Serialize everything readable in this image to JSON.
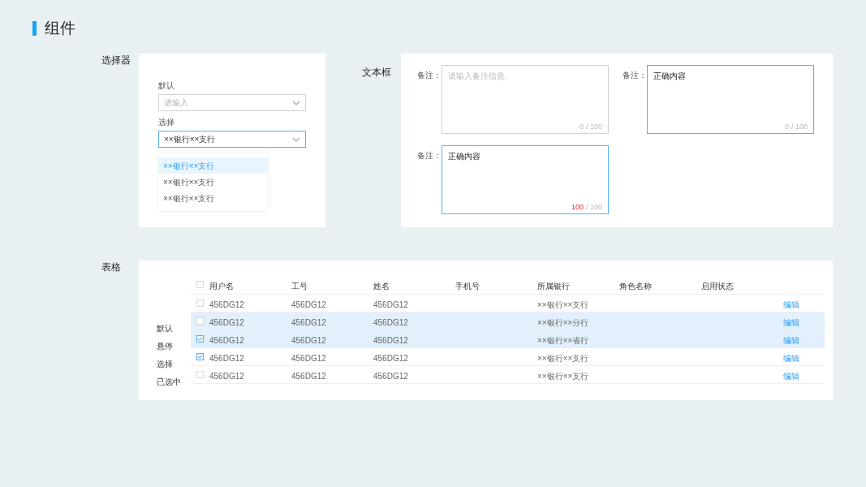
{
  "page_title": "组件",
  "selector": {
    "section_label": "选择器",
    "fields": [
      {
        "label": "默认",
        "placeholder": "请输入",
        "focused": false
      },
      {
        "label": "选择",
        "value": "××银行××支行",
        "focused": true
      }
    ],
    "options": [
      {
        "label": "××银行××支行",
        "selected": true
      },
      {
        "label": "××银行××支行",
        "selected": false
      },
      {
        "label": "××银行××支行",
        "selected": false
      }
    ]
  },
  "textbox": {
    "section_label": "文本框",
    "fields": [
      {
        "label": "备注：",
        "placeholder": "请输入备注信息",
        "focused": false,
        "count": "0",
        "limit": "/ 100",
        "at_limit": false
      },
      {
        "label": "备注：",
        "value": "正确内容",
        "focused": true,
        "count": "0",
        "limit": "/ 100",
        "at_limit": false
      },
      {
        "label": "备注：",
        "value": "正确内容",
        "focused": true,
        "count": "100",
        "limit": "/ 100",
        "at_limit": true
      }
    ]
  },
  "table": {
    "section_label": "表格",
    "header_checked": false,
    "columns": [
      "用户名",
      "工号",
      "姓名",
      "手机号",
      "所属银行",
      "角色名称",
      "启用状态"
    ],
    "rows": [
      {
        "highlighted": false,
        "checked": false,
        "cells": [
          "456DG12",
          "456DG12",
          "456DG12",
          null,
          "××银行××支行",
          null,
          null
        ],
        "action": "编辑"
      },
      {
        "state_label": "默认",
        "highlighted": true,
        "checked": false,
        "cells": [
          "456DG12",
          "456DG12",
          "456DG12",
          null,
          "××银行××分行",
          null,
          null
        ],
        "action": "编辑"
      },
      {
        "state_label": "悬停",
        "highlighted": true,
        "checked": true,
        "cells": [
          "456DG12",
          "456DG12",
          "456DG12",
          null,
          "××银行××省行",
          null,
          null
        ],
        "action": "编辑"
      },
      {
        "state_label": "选择",
        "highlighted": false,
        "checked": true,
        "cells": [
          "456DG12",
          "456DG12",
          "456DG12",
          null,
          "××银行××支行",
          null,
          null
        ],
        "action": "编辑"
      },
      {
        "state_label": "已选中",
        "highlighted": false,
        "checked": false,
        "cells": [
          "456DG12",
          "456DG12",
          "456DG12",
          null,
          "××银行××支行",
          null,
          null
        ],
        "action": "编辑"
      }
    ]
  }
}
